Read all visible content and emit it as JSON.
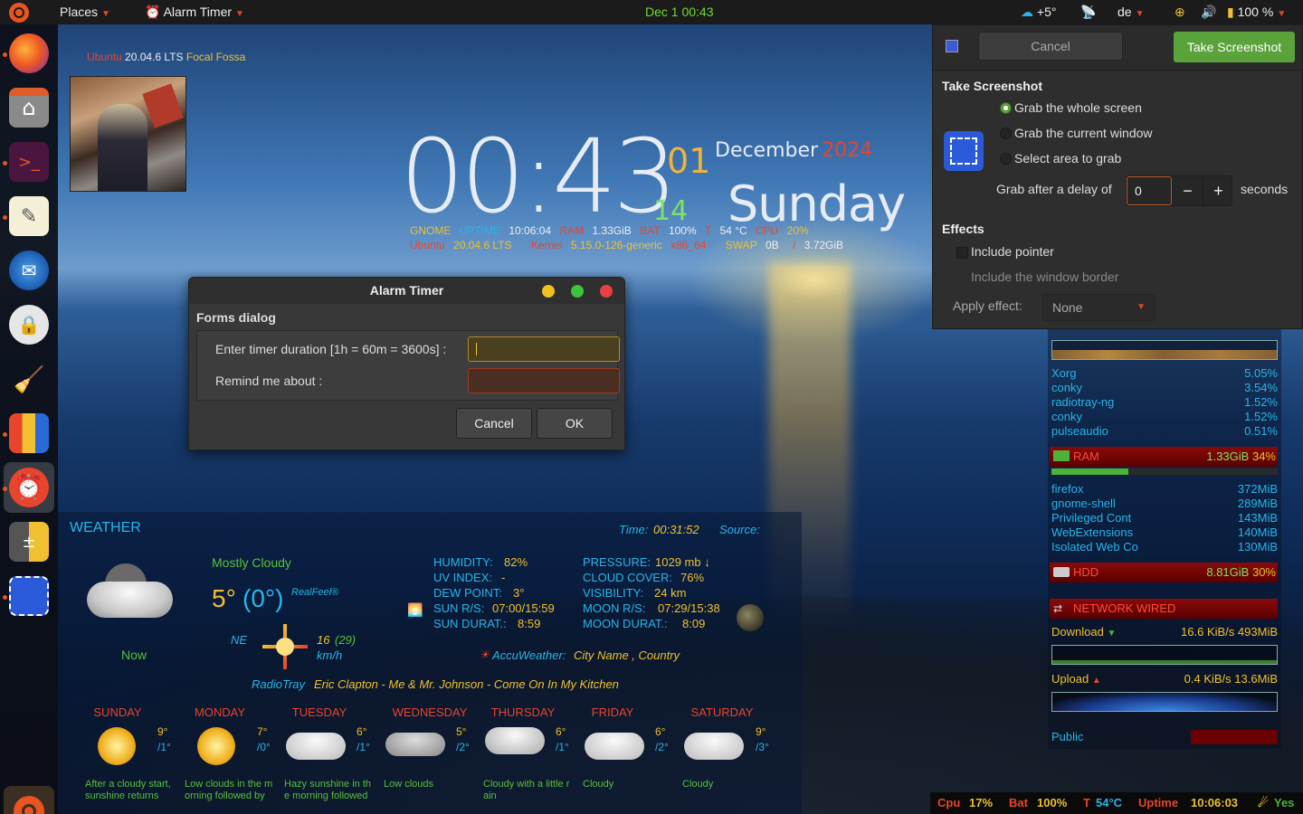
{
  "topbar": {
    "places": "Places",
    "alarm_timer": "Alarm Timer",
    "datetime": "Dec 1  00:43",
    "weather": "+5°",
    "keyboard": "de",
    "battery": "100 %"
  },
  "dock": {
    "apps": [
      "firefox-icon",
      "files-icon",
      "terminal-icon",
      "text-editor-icon",
      "thunderbird-icon",
      "keepassxc-icon",
      "bleachbit-icon",
      "pencils-icon",
      "alarm-clock-icon",
      "calculator-icon",
      "screenshot-icon"
    ]
  },
  "conky_clock": {
    "os_name": "Ubuntu",
    "os_version": "20.04.6 LTS",
    "os_codename": "Focal Fossa",
    "time": "00:43",
    "day": "01",
    "seconds": "14",
    "month": "December",
    "year": "2024",
    "weekday": "Sunday",
    "row1": {
      "gnome_label": "GNOME",
      "uptime_label": "UPTIME",
      "uptime": "10:06:04",
      "ram_label": "RAM",
      "ram": "1.33GiB",
      "bat_label": "BAT",
      "bat": "100%",
      "t_label": "T",
      "temp": "54 °C",
      "cpu_label": "CPU",
      "cpu": "20%"
    },
    "row2": {
      "ubuntu_label": "Ubuntu",
      "version": "20.04.6 LTS",
      "kernel_label": "Kernel",
      "kernel": "5.15.0-126-generic",
      "arch": "x86_64",
      "swap_label": "SWAP",
      "swap": "0B",
      "slash": "/",
      "swap_total": "3.72GiB"
    }
  },
  "alarm_dialog": {
    "title": "Alarm Timer",
    "group_label": "Forms dialog",
    "duration_label": "Enter timer duration [1h = 60m = 3600s] :",
    "duration_value": "",
    "remind_label": "Remind me about :",
    "remind_value": "",
    "cancel": "Cancel",
    "ok": "OK"
  },
  "screenshot": {
    "cancel": "Cancel",
    "take": "Take Screenshot",
    "heading": "Take Screenshot",
    "options": [
      "Grab the whole screen",
      "Grab the current window",
      "Select area to grab"
    ],
    "selected_option": 0,
    "delay_label": "Grab after a delay of",
    "delay_value": "0",
    "delay_unit": "seconds",
    "minus": "−",
    "plus": "+",
    "effects_heading": "Effects",
    "include_pointer": "Include pointer",
    "include_border": "Include the window border",
    "apply_effect_label": "Apply effect:",
    "apply_effect_value": "None"
  },
  "weather": {
    "title": "WEATHER",
    "time_label": "Time:",
    "time": "00:31:52",
    "source_label": "Source:",
    "condition": "Mostly Cloudy",
    "temp": "5°",
    "feels": "(0°)",
    "realfeel": "RealFeel®",
    "now": "Now",
    "wind_dir": "NE",
    "wind_speed": "16",
    "wind_gust": "(29)",
    "wind_unit": "km/h",
    "humidity_label": "HUMIDITY:",
    "humidity": "82%",
    "uv_label": "UV INDEX:",
    "uv": "-",
    "dew_label": "DEW POINT:",
    "dew": "3°",
    "sun_rs_label": "SUN R/S:",
    "sun_rs": "07:00/15:59",
    "sun_dur_label": "SUN DURAT.:",
    "sun_dur": "8:59",
    "pressure_label": "PRESSURE:",
    "pressure": "1029 mb ↓",
    "cloud_label": "CLOUD COVER:",
    "cloud": "76%",
    "vis_label": "VISIBILITY:",
    "vis": "24 km",
    "moon_rs_label": "MOON R/S:",
    "moon_rs": "07:29/15:38",
    "moon_dur_label": "MOON DURAT.:",
    "moon_dur": "8:09",
    "accuweather": "AccuWeather:",
    "location": "City Name ,  Country",
    "radiotray": "RadioTray",
    "song": "Eric Clapton - Me & Mr. Johnson - Come On In My Kitchen",
    "forecast": [
      {
        "day": "SUNDAY",
        "high": "9°",
        "low": "/1°",
        "desc": "After a cloudy start, sunshine returns"
      },
      {
        "day": "MONDAY",
        "high": "7°",
        "low": "/0°",
        "desc": "Low clouds in the morning followed by"
      },
      {
        "day": "TUESDAY",
        "high": "6°",
        "low": "/1°",
        "desc": "Hazy sunshine in the morning followed"
      },
      {
        "day": "WEDNESDAY",
        "high": "5°",
        "low": "/2°",
        "desc": "Low clouds"
      },
      {
        "day": "THURSDAY",
        "high": "6°",
        "low": "/1°",
        "desc": "Cloudy with a little rain"
      },
      {
        "day": "FRIDAY",
        "high": "6°",
        "low": "/2°",
        "desc": "Cloudy"
      },
      {
        "day": "SATURDAY",
        "high": "9°",
        "low": "/3°",
        "desc": "Cloudy"
      }
    ]
  },
  "sysmon": {
    "processes": [
      {
        "name": "Xorg",
        "value": "5.05%"
      },
      {
        "name": "conky",
        "value": "3.54%"
      },
      {
        "name": "radiotray-ng",
        "value": "1.52%"
      },
      {
        "name": "conky",
        "value": "1.52%"
      },
      {
        "name": "pulseaudio",
        "value": "0.51%"
      }
    ],
    "ram_label": "RAM",
    "ram_value": "1.33GiB",
    "ram_pct": "34%",
    "ram_fraction": 0.34,
    "mem_processes": [
      {
        "name": "firefox",
        "value": "372MiB"
      },
      {
        "name": "gnome-shell",
        "value": "289MiB"
      },
      {
        "name": "Privileged Cont",
        "value": "143MiB"
      },
      {
        "name": "WebExtensions",
        "value": "140MiB"
      },
      {
        "name": "Isolated Web Co",
        "value": "130MiB"
      }
    ],
    "hdd_label": "HDD",
    "hdd_value": "8.81GiB",
    "hdd_pct": "30%",
    "net_label": "NETWORK WIRED",
    "download_label": "Download",
    "download_rate": "16.6 KiB/s",
    "download_total": "493MiB",
    "upload_label": "Upload",
    "upload_rate": "0.4 KiB/s",
    "upload_total": "13.6MiB",
    "public_label": "Public"
  },
  "bottombar": {
    "cpu_label": "Cpu",
    "cpu": "17%",
    "bat_label": "Bat",
    "bat": "100%",
    "t_label": "T",
    "temp": "54°C",
    "uptime_label": "Uptime",
    "uptime": "10:06:03",
    "yes": "Yes"
  },
  "colors": {
    "accent_green": "#5aa33b",
    "ubuntu_orange": "#e95420",
    "conky_cyan": "#2ab5e8",
    "conky_yellow": "#f0c030",
    "conky_red": "#e8452c"
  }
}
